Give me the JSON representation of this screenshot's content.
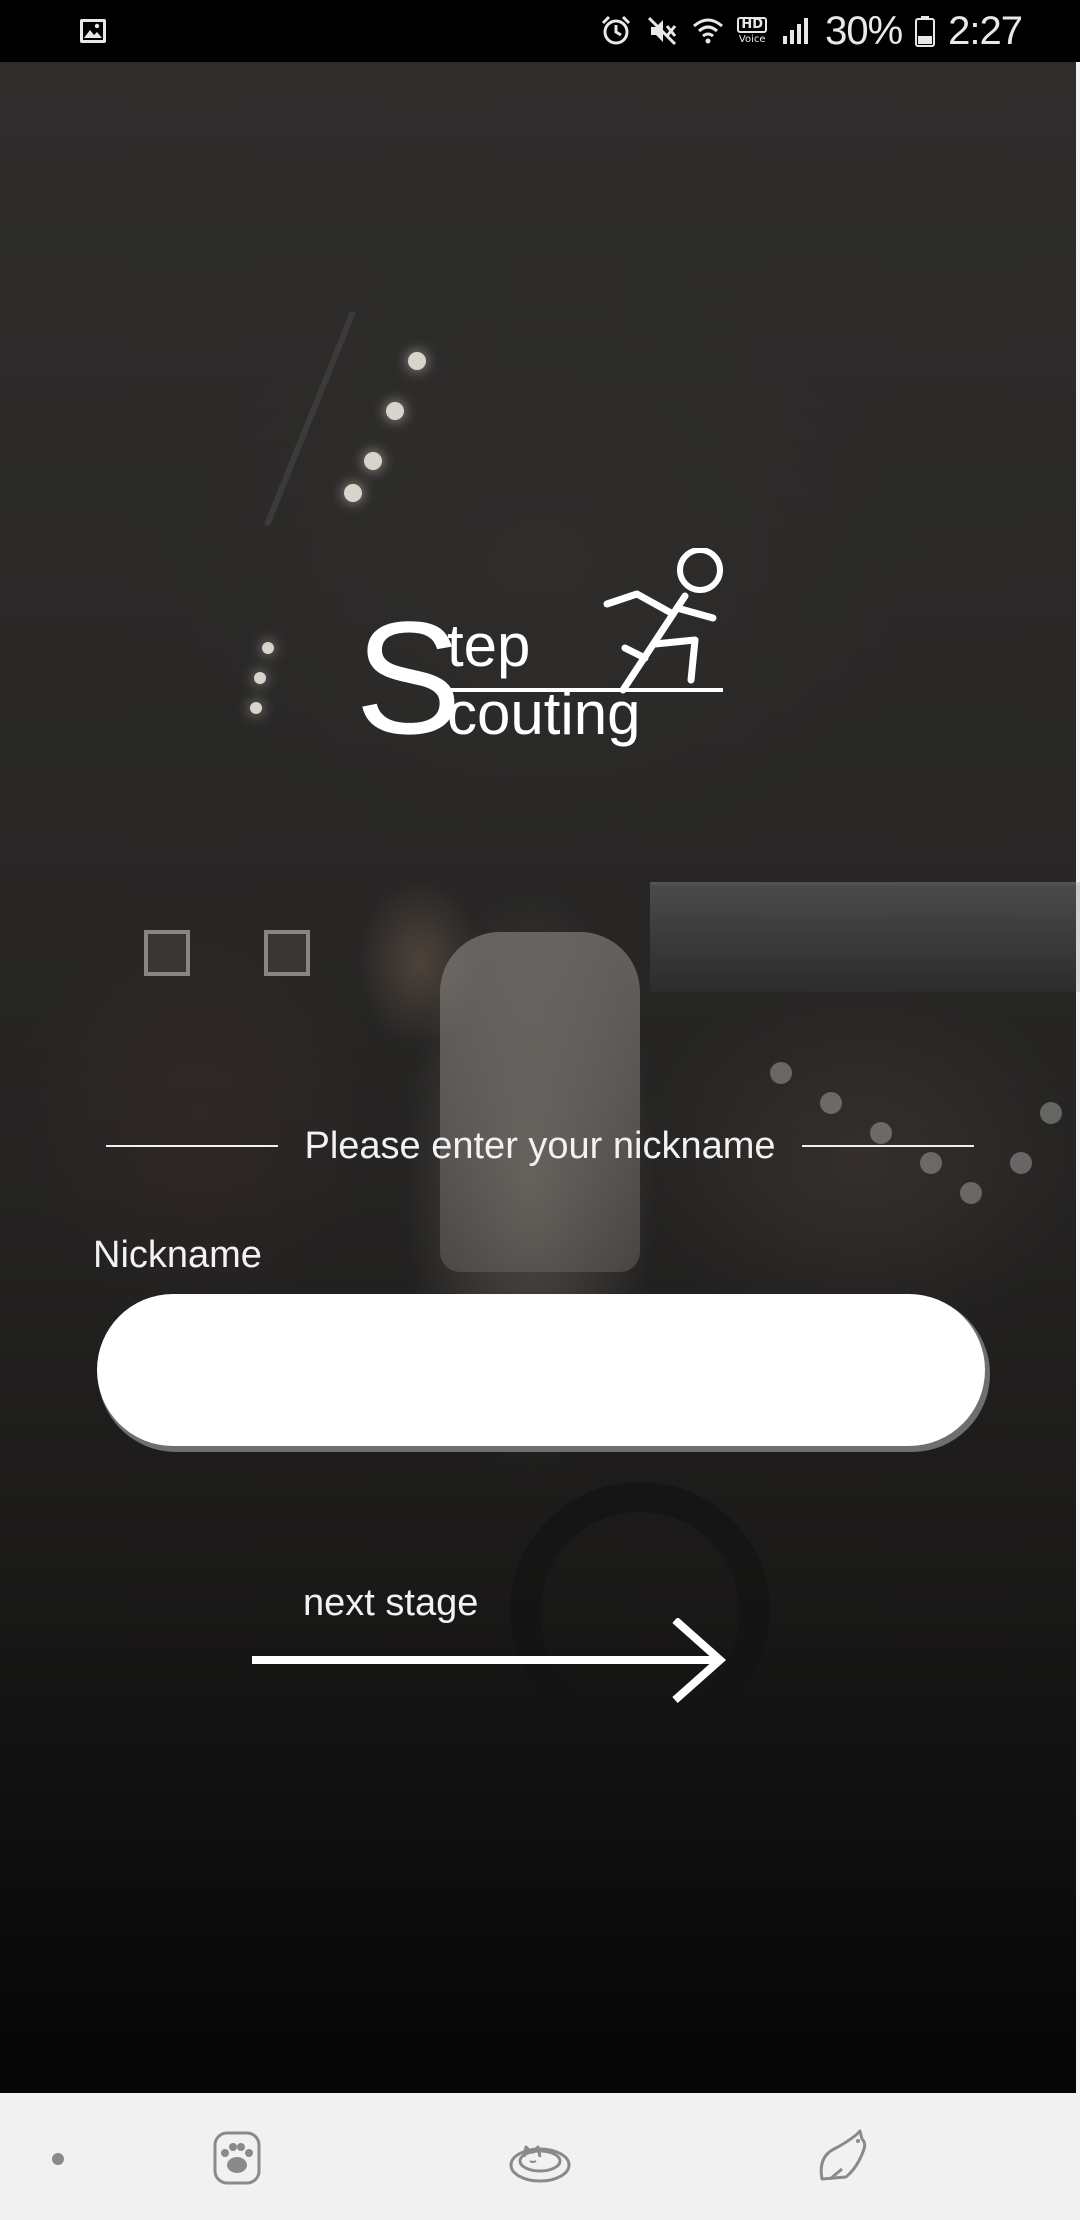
{
  "status_bar": {
    "battery": "30%",
    "time": "2:27",
    "hd_top": "HD",
    "hd_bottom": "Voice",
    "icons": [
      "gallery-icon",
      "alarm-icon",
      "mute-icon",
      "wifi-icon",
      "hd-voice-icon",
      "signal-icon",
      "battery-icon"
    ]
  },
  "logo": {
    "line1": "tep",
    "line2": "couting",
    "initial": "S"
  },
  "form": {
    "prompt": "Please enter your nickname",
    "nickname_label": "Nickname",
    "nickname_value": "",
    "nickname_placeholder": ""
  },
  "next": {
    "label": "next stage"
  },
  "bottom_nav": {
    "items": [
      "paw-icon",
      "sleeping-cat-icon",
      "stretching-cat-icon"
    ]
  },
  "colors": {
    "text": "#f2f2f2",
    "nav_bg": "#f1f1f1",
    "input_bg": "#ffffff",
    "icon_gray": "#8a8a8a"
  }
}
